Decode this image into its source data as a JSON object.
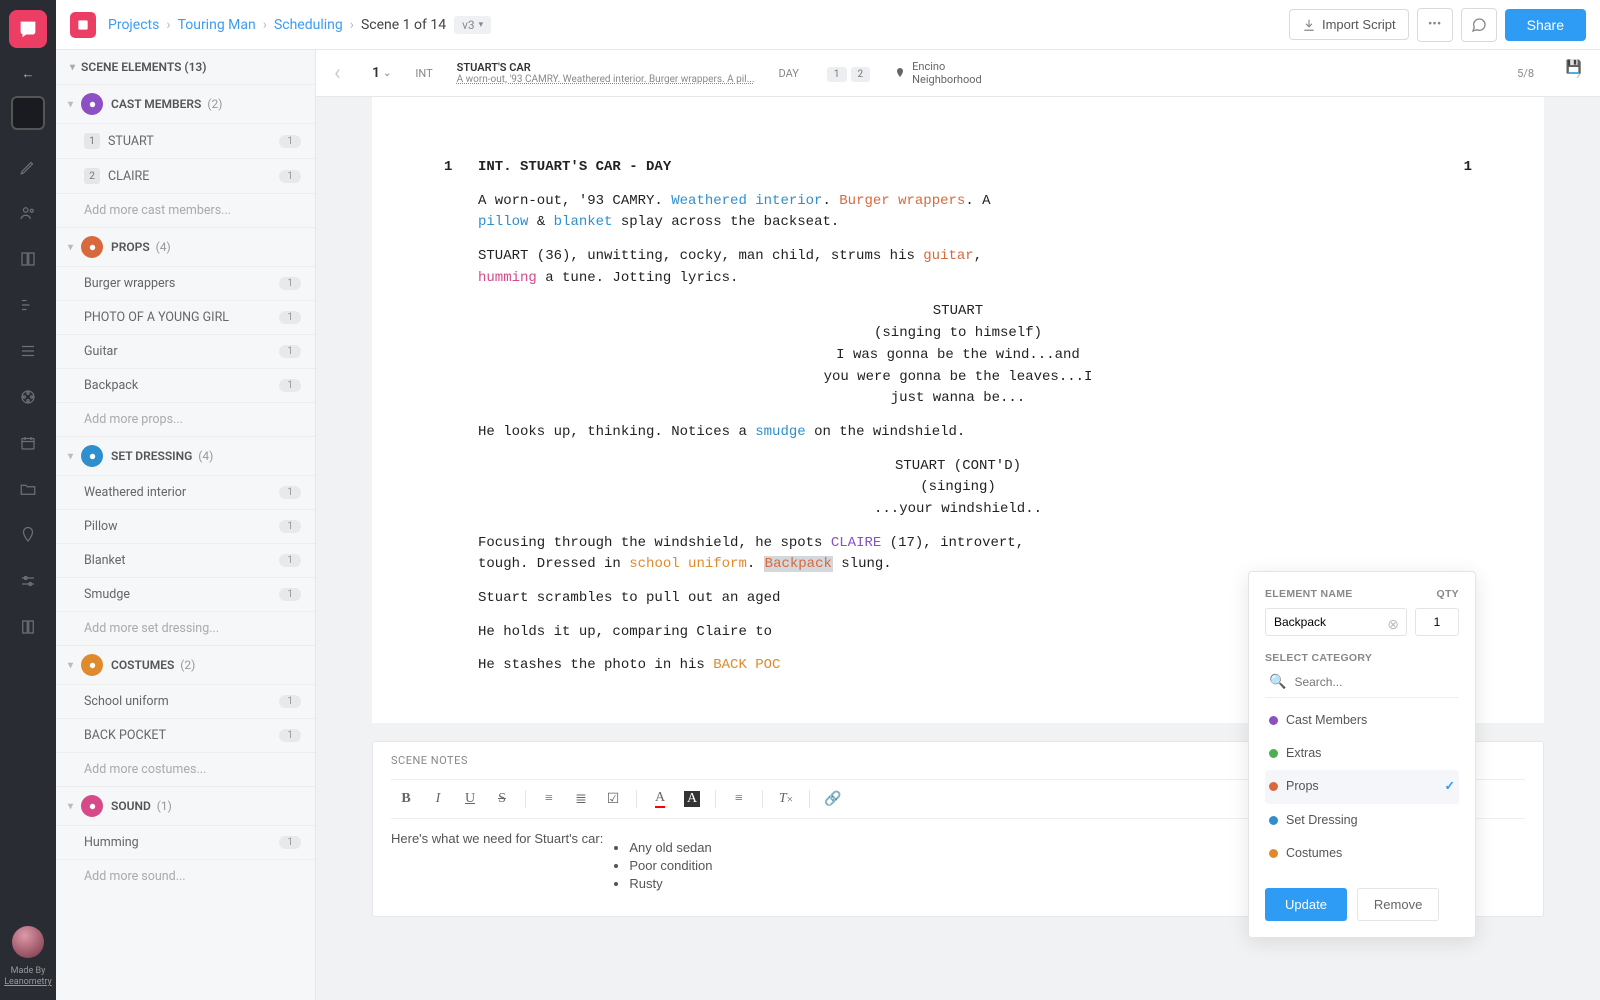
{
  "topbar": {
    "crumbs": [
      "Projects",
      "Touring Man",
      "Scheduling"
    ],
    "current": "Scene 1 of 14",
    "version": "v3",
    "import": "Import Script",
    "share": "Share"
  },
  "rail": {
    "made1": "Made By",
    "made2": "Leanometry"
  },
  "sidebar": {
    "header": "SCENE ELEMENTS  (13)",
    "groups": [
      {
        "name": "CAST MEMBERS",
        "count": "(2)",
        "color": "#8c4fc4",
        "items": [
          {
            "n": "1",
            "t": "STUART",
            "c": "1"
          },
          {
            "n": "2",
            "t": "CLAIRE",
            "c": "1"
          }
        ],
        "add": "Add more cast members..."
      },
      {
        "name": "PROPS",
        "count": "(4)",
        "color": "#d8693c",
        "items": [
          {
            "t": "Burger wrappers",
            "c": "1"
          },
          {
            "t": "PHOTO OF A YOUNG GIRL",
            "c": "1"
          },
          {
            "t": "Guitar",
            "c": "1"
          },
          {
            "t": "Backpack",
            "c": "1"
          }
        ],
        "add": "Add more props..."
      },
      {
        "name": "SET DRESSING",
        "count": "(4)",
        "color": "#2e8fce",
        "items": [
          {
            "t": "Weathered interior",
            "c": "1"
          },
          {
            "t": "Pillow",
            "c": "1"
          },
          {
            "t": "Blanket",
            "c": "1"
          },
          {
            "t": "Smudge",
            "c": "1"
          }
        ],
        "add": "Add more set dressing..."
      },
      {
        "name": "COSTUMES",
        "count": "(2)",
        "color": "#e08a2e",
        "items": [
          {
            "t": "School uniform",
            "c": "1"
          },
          {
            "t": "BACK POCKET",
            "c": "1"
          }
        ],
        "add": "Add more costumes..."
      },
      {
        "name": "SOUND",
        "count": "(1)",
        "color": "#d64a8a",
        "items": [
          {
            "t": "Humming",
            "c": "1"
          }
        ],
        "add": "Add more sound..."
      }
    ]
  },
  "strip": {
    "index": "1",
    "ie": "INT",
    "title": "STUART'S CAR",
    "desc": "A worn-out, '93 CAMRY. Weathered interior. Burger wrappers. A pil...",
    "tod": "DAY",
    "chips": [
      "1",
      "2"
    ],
    "loc1": "Encino",
    "loc2": "Neighborhood",
    "len": "5/8"
  },
  "script": {
    "nl": "1",
    "nr": "1",
    "slug": "INT. STUART'S CAR - DAY",
    "char1": "STUART",
    "par1": "(singing to himself)",
    "d1": "I was gonna be the wind...and",
    "d2": "you were gonna be the leaves...I",
    "d3": "just wanna be...",
    "char2": "STUART (CONT'D)",
    "par2": "(singing)",
    "d4": "...your windshield.."
  },
  "notes": {
    "title": "SCENE NOTES",
    "lead": "Here's what we need for Stuart's car:",
    "items": [
      "Any old sedan",
      "Poor condition",
      "Rusty"
    ]
  },
  "popup": {
    "elLabel": "ELEMENT NAME",
    "qtyLabel": "QTY",
    "elVal": "Backpack",
    "qtyVal": "1",
    "catLabel": "SELECT CATEGORY",
    "search": "Search...",
    "cats": [
      {
        "t": "Cast Members",
        "c": "#8c4fc4"
      },
      {
        "t": "Extras",
        "c": "#4caf50"
      },
      {
        "t": "Props",
        "c": "#d8693c",
        "sel": true
      },
      {
        "t": "Set Dressing",
        "c": "#2e8fce"
      },
      {
        "t": "Costumes",
        "c": "#e08a2e"
      }
    ],
    "update": "Update",
    "remove": "Remove"
  }
}
